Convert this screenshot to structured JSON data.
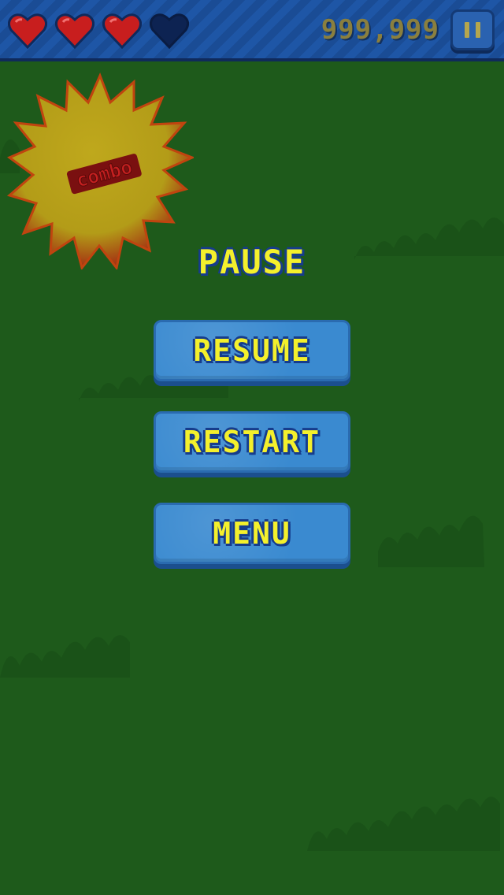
{
  "hud": {
    "hearts": [
      {
        "state": "full",
        "color": "#c81e1e"
      },
      {
        "state": "full",
        "color": "#c81e1e"
      },
      {
        "state": "full",
        "color": "#c81e1e"
      },
      {
        "state": "empty",
        "color": "#0d2352"
      }
    ],
    "score": "999,999",
    "pause_icon": "pause-icon"
  },
  "combo_badge": {
    "label": "combo",
    "burst_color": "#b8a21a",
    "label_color": "#a01a1a"
  },
  "pause_menu": {
    "title": "PAUSE",
    "resume_label": "RESUME",
    "restart_label": "RESTART",
    "menu_label": "MENU"
  },
  "colors": {
    "background": "#1e5a1b",
    "button": "#3a8ad0",
    "text_yellow": "#f4f02c",
    "text_outline": "#163c8c"
  }
}
